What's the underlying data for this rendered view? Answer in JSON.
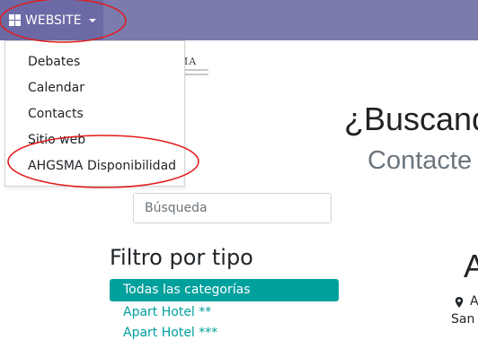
{
  "navbar": {
    "app_menu_label": "WEBSITE",
    "apps_icon": "grid-icon",
    "caret_icon": "caret-down-icon"
  },
  "logo": {
    "text": "MA"
  },
  "dropdown": {
    "items": [
      {
        "label": "Debates"
      },
      {
        "label": "Calendar"
      },
      {
        "label": "Contacts"
      },
      {
        "label": "Sitio web"
      },
      {
        "label": "AHGSMA Disponibilidad"
      }
    ]
  },
  "hero": {
    "title": "¿Buscand",
    "subtitle": "Contacte"
  },
  "search": {
    "placeholder": "Búsqueda",
    "value": ""
  },
  "filter": {
    "heading": "Filtro por tipo",
    "categories": [
      {
        "label": "Todas las categorías",
        "active": true
      },
      {
        "label": "Apart Hotel **",
        "active": false
      },
      {
        "label": "Apart Hotel ***",
        "active": false
      }
    ]
  },
  "listing": {
    "title_fragment": "A",
    "address_line1": "A",
    "address_line2": "San"
  },
  "colors": {
    "navbar": "#7c7bad",
    "navbar_active": "#6b6aa6",
    "accent": "#00a09d",
    "annotation": "#e31b1b"
  }
}
